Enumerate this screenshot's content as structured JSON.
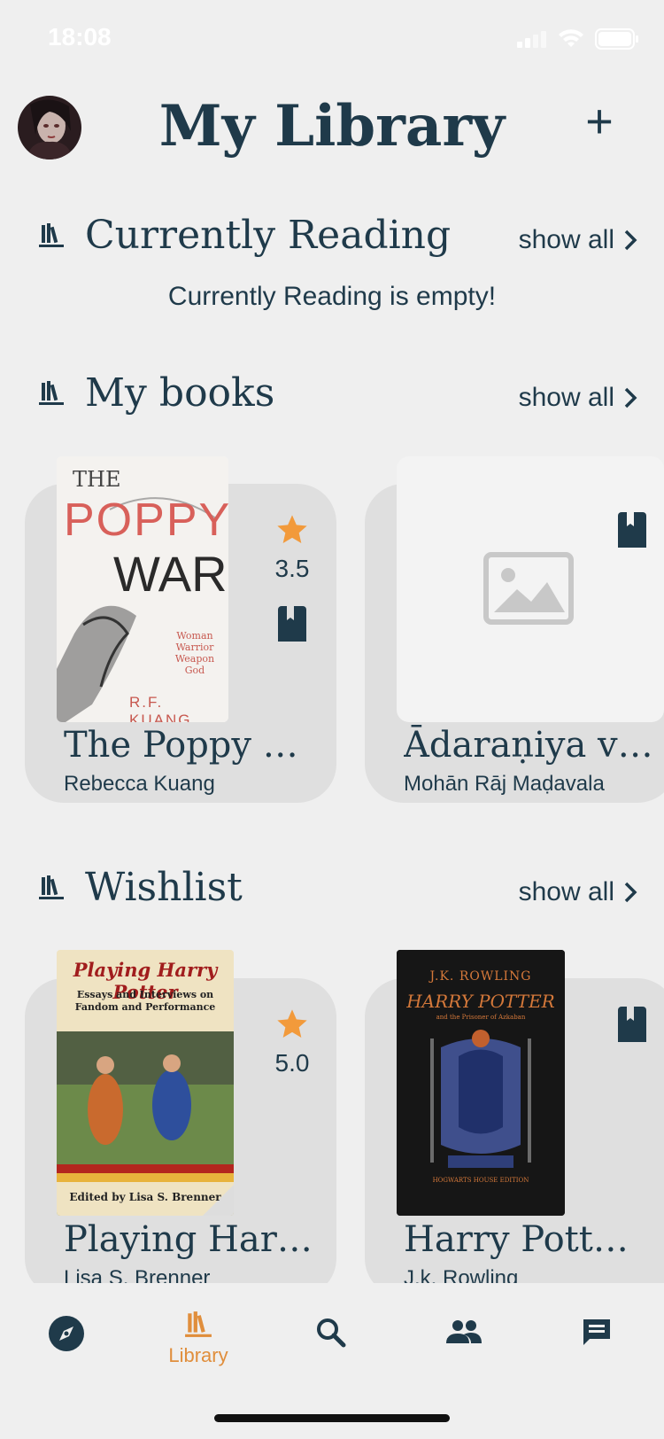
{
  "status_bar": {
    "time": "18:08"
  },
  "header": {
    "title": "My Library",
    "add_label": "+",
    "avatar_icon": "user-avatar"
  },
  "sections": {
    "currently_reading": {
      "title": "Currently Reading",
      "show_all": "show all",
      "empty_text": "Currently Reading is empty!"
    },
    "my_books": {
      "title": "My books",
      "show_all": "show all"
    },
    "wishlist": {
      "title": "Wishlist",
      "show_all": "show all"
    }
  },
  "my_books": [
    {
      "title": "The Poppy War",
      "author": "Rebecca Kuang",
      "rating": "3.5",
      "cover_title_1": "THE",
      "cover_title_2": "POPPY",
      "cover_title_3": "WAR",
      "cover_author": "R.F. KUANG",
      "cover_tagline": "Woman Warrior Weapon God"
    },
    {
      "title": "Ādaraṇiya vik...",
      "author": "Mohān Rāj Maḍavala"
    }
  ],
  "wishlist": [
    {
      "title": "Playing Harry...",
      "author": "Lisa S. Brenner",
      "rating": "5.0",
      "cover_title": "Playing Harry Potter",
      "cover_subtitle": "Essays and Interviews on Fandom and Performance",
      "cover_editor": "Edited by Lisa S. Brenner"
    },
    {
      "title": "Harry Potter ...",
      "author": "J.k. Rowling",
      "cover_author": "J.K. ROWLING",
      "cover_title": "HARRY POTTER",
      "cover_subtitle": "and the Prisoner of Azkaban",
      "cover_edition": "HOGWARTS HOUSE EDITION"
    }
  ],
  "nav": [
    {
      "label": "",
      "icon": "compass-icon"
    },
    {
      "label": "Library",
      "icon": "library-icon"
    },
    {
      "label": "",
      "icon": "search-icon"
    },
    {
      "label": "",
      "icon": "friends-icon"
    },
    {
      "label": "",
      "icon": "chat-icon"
    }
  ],
  "colors": {
    "primary": "#1f3a4a",
    "accent": "#e08e3c",
    "star": "#f29a3b",
    "card": "#dfdfdf",
    "background": "#efefef"
  }
}
